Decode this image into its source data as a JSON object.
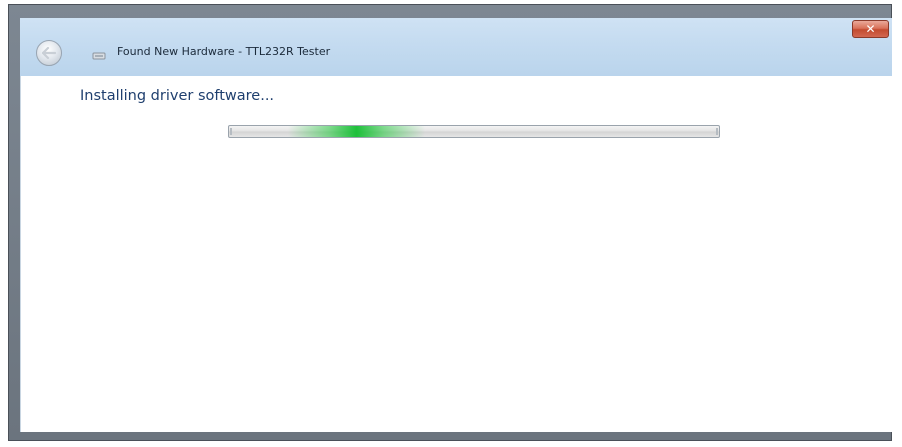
{
  "window": {
    "title": "Found New Hardware - TTL232R Tester",
    "close_glyph": "✕"
  },
  "icons": {
    "back": "back-arrow-icon",
    "hardware": "hardware-device-icon",
    "close": "close-icon"
  },
  "main": {
    "heading": "Installing driver software..."
  },
  "progress": {
    "mode": "indeterminate-marquee",
    "highlight_start_fraction": 0.12,
    "highlight_width_fraction": 0.28,
    "glow_color": "#22c83c"
  },
  "colors": {
    "titlebar": "#c4dbf0",
    "frame": "#757e88",
    "heading_text": "#1f3f6e",
    "close_button": "#c34b30"
  }
}
